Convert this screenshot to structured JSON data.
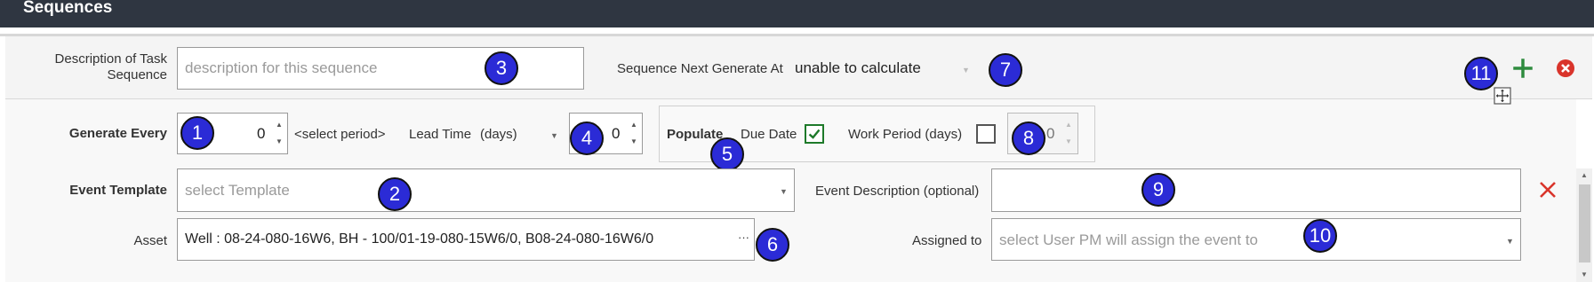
{
  "header": {
    "title": "Sequences"
  },
  "task_description": {
    "label_line1": "Description of Task",
    "label_line2": "Sequence",
    "placeholder": "description for this sequence",
    "marker": "3"
  },
  "next_generate": {
    "label": "Sequence Next Generate At",
    "value": "unable to calculate",
    "marker": "7"
  },
  "header_actions": {
    "marker": "11",
    "add_icon": "plus-icon",
    "remove_icon": "circle-x-icon",
    "move_icon": "move-icon"
  },
  "generate_every": {
    "label": "Generate Every",
    "value": "0",
    "marker": "1",
    "period_placeholder": "<select period>"
  },
  "lead_time": {
    "label": "Lead Time",
    "unit": "(days)",
    "value": "0",
    "marker": "4"
  },
  "populate": {
    "label": "Populate",
    "marker": "5",
    "due_date_label": "Due Date",
    "due_date_checked": true,
    "work_period_label": "Work Period (days)",
    "work_period_checked": false,
    "work_period_value": "0",
    "work_period_marker": "8"
  },
  "event_template": {
    "label": "Event Template",
    "placeholder": "select Template",
    "marker": "2"
  },
  "event_description": {
    "label": "Event Description (optional)",
    "value": "",
    "marker": "9",
    "clear_icon": "x-icon"
  },
  "asset": {
    "label": "Asset",
    "value": "Well : 08-24-080-16W6, BH - 100/01-19-080-15W6/0,  B08-24-080-16W6/0",
    "ellipsis": "···",
    "marker": "6"
  },
  "assigned_to": {
    "label": "Assigned to",
    "placeholder": "select User PM will assign the event to",
    "marker": "10"
  },
  "colors": {
    "header_bg": "#2f3641",
    "marker_bg": "#2b2bd6",
    "add_green": "#2e8b3e",
    "remove_red": "#d9342b"
  }
}
